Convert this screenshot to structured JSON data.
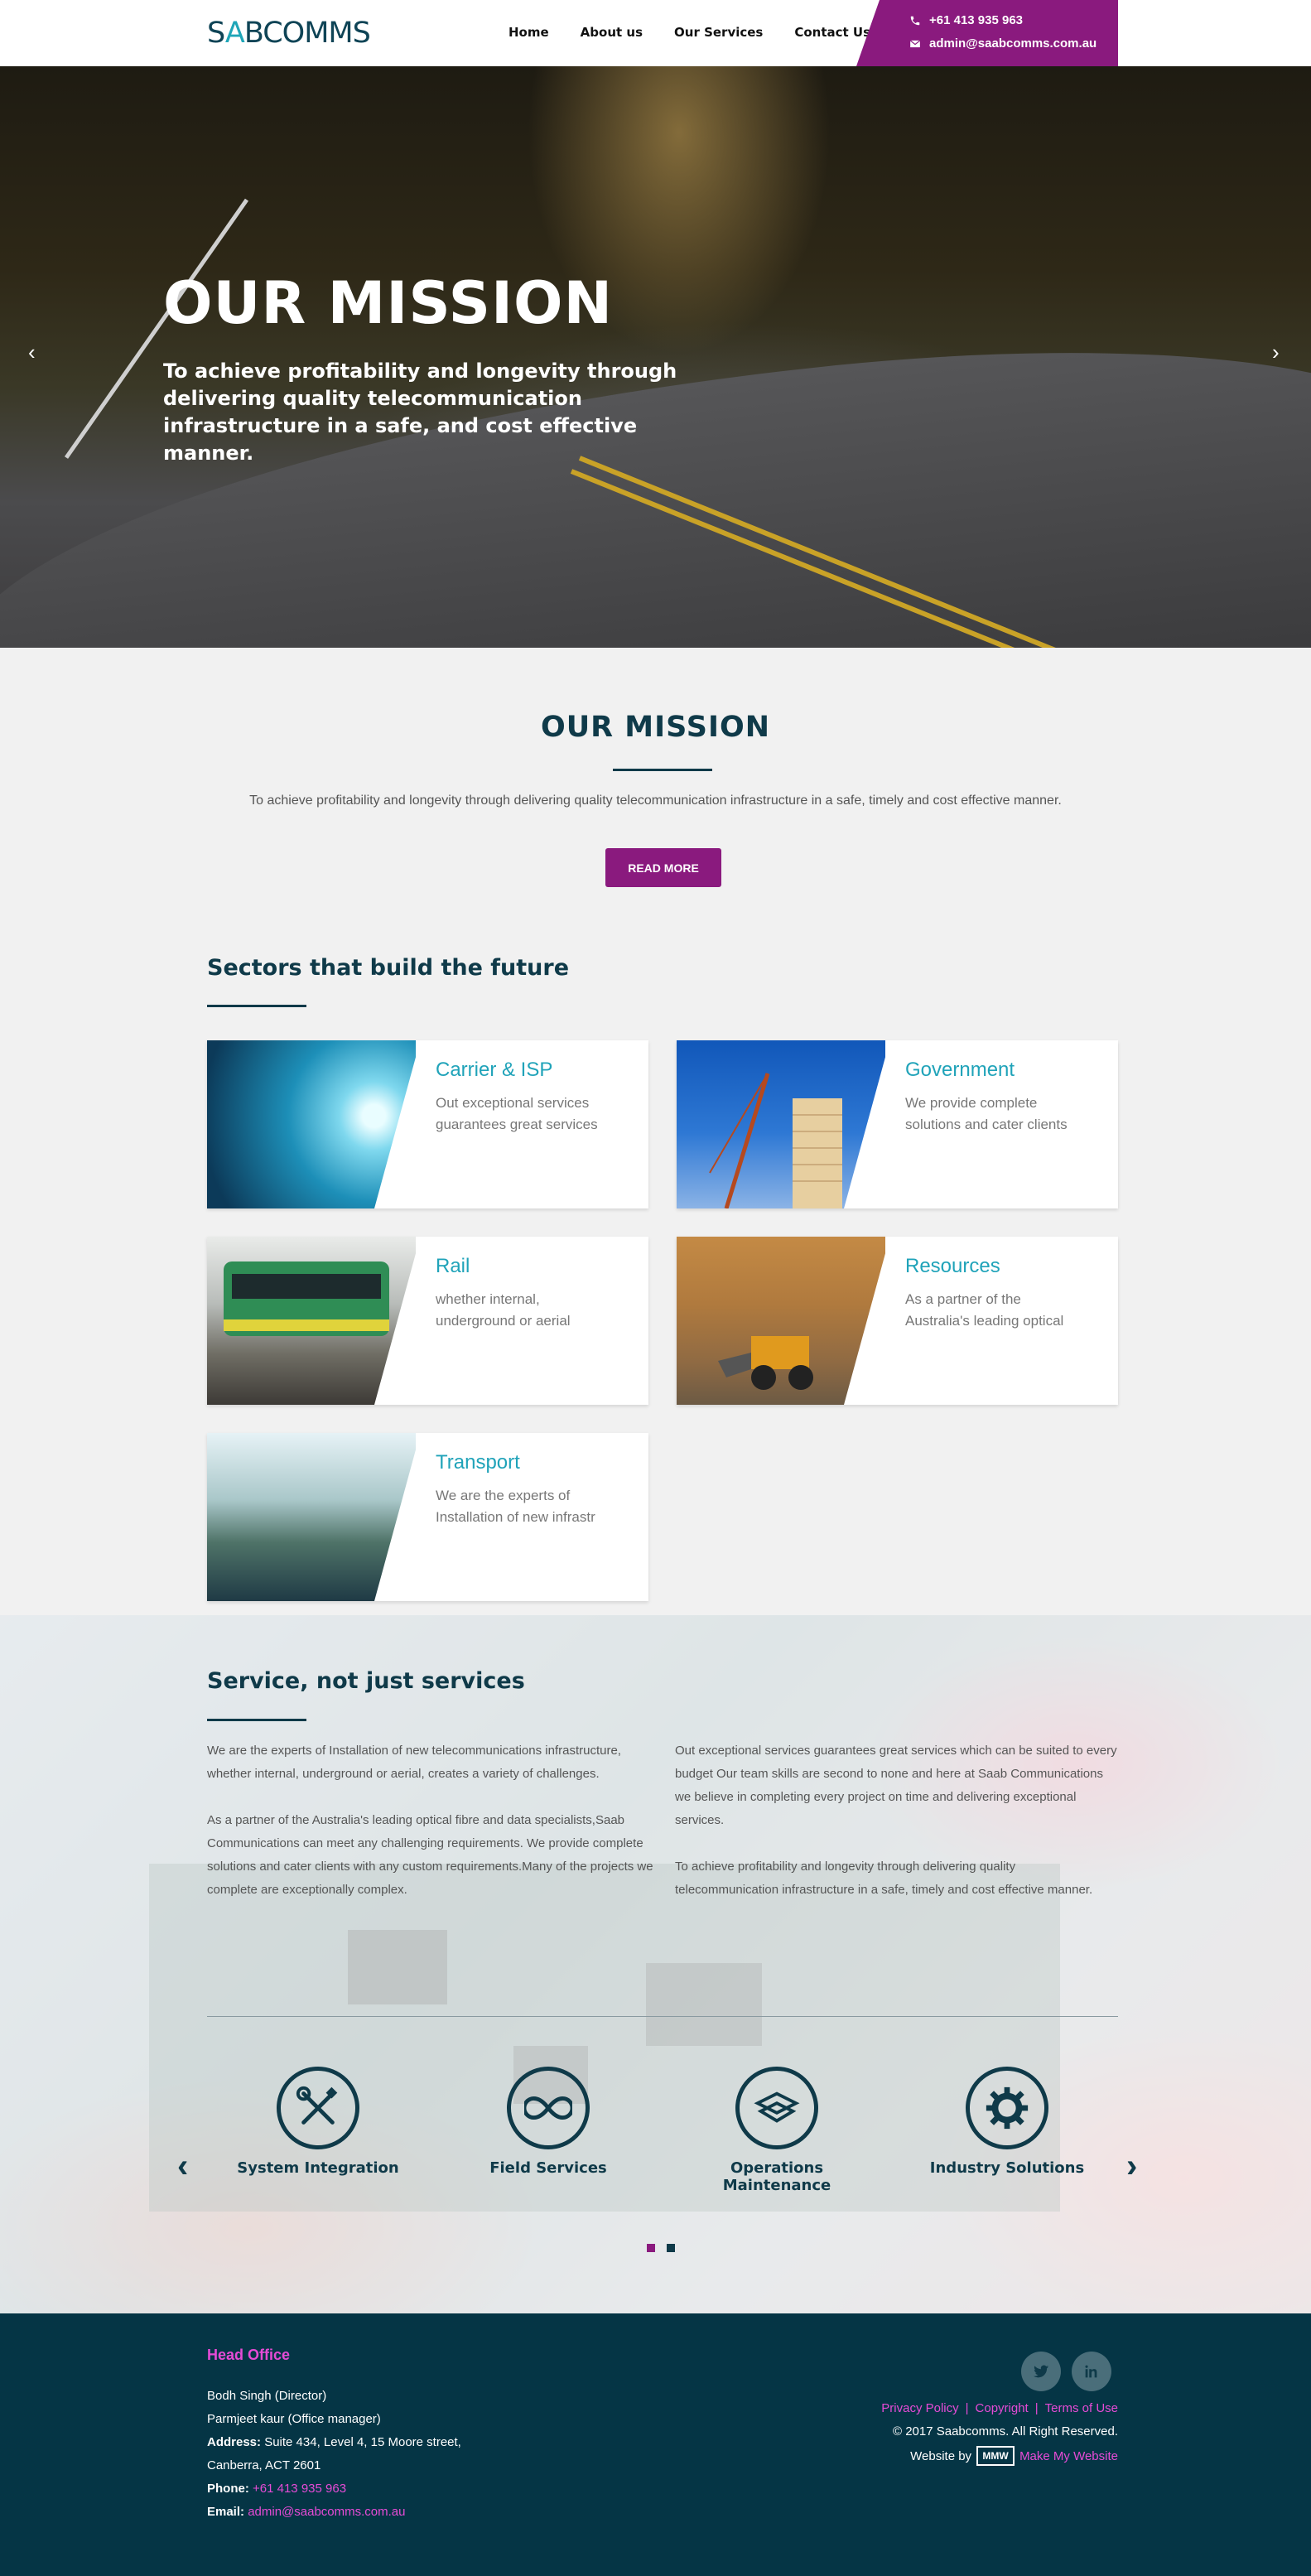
{
  "header": {
    "logo_text_1": "S",
    "logo_text_a": "A",
    "logo_text_2": "BCOMMS",
    "nav": [
      "Home",
      "About us",
      "Our Services",
      "Contact Us"
    ],
    "phone": "+61 413 935 963",
    "email": "admin@saabcomms.com.au"
  },
  "hero": {
    "title": "OUR MISSION",
    "subtitle": "To achieve profitability and longevity through delivering quality telecommunication infrastructure in a safe, and cost effective manner.",
    "prev_icon": "chevron-left-icon",
    "next_icon": "chevron-right-icon"
  },
  "mission": {
    "title": "OUR MISSION",
    "text": "To achieve profitability and longevity through delivering quality telecommunication infrastructure in a safe, timely and cost effective manner.",
    "button": "READ MORE"
  },
  "sectors": {
    "title": "Sectors that build the future",
    "cards": [
      {
        "title": "Carrier & ISP",
        "desc": "Out exceptional services guarantees great services"
      },
      {
        "title": "Government",
        "desc": "We provide complete solutions and cater clients"
      },
      {
        "title": "Rail",
        "desc": "whether internal, underground or aerial"
      },
      {
        "title": "Resources",
        "desc": "As a partner of the Australia's leading optical"
      },
      {
        "title": "Transport",
        "desc": "We are the experts of Installation of new infrastr"
      }
    ]
  },
  "services": {
    "title": "Service, not just services",
    "left": [
      "We are the experts of Installation of new telecommunications infrastructure, whether internal, underground or aerial, creates a variety of challenges.",
      "As a partner of the Australia's leading optical fibre and data specialists,Saab Communications can meet any challenging requirements. We provide complete solutions and cater clients with any custom requirements.Many of the projects we complete are exceptionally complex."
    ],
    "right": [
      "Out exceptional services guarantees great services which can be suited to every budget Our team skills are second to none and here at Saab Communications we believe in completing every project on time and delivering exceptional services.",
      "To achieve profitability and longevity through delivering quality telecommunication infrastructure in a safe, timely and cost effective manner."
    ],
    "items": [
      {
        "label": "System Integration",
        "icon": "tools-icon"
      },
      {
        "label": "Field Services",
        "icon": "infinity-icon"
      },
      {
        "label": "Operations Maintenance",
        "icon": "layers-icon"
      },
      {
        "label": "Industry Solutions",
        "icon": "gear-icon"
      }
    ],
    "dot_colors": [
      "#8a1a7e",
      "#0f3a49"
    ]
  },
  "footer": {
    "head": "Head Office",
    "person1": "Bodh Singh (Director)",
    "person2": "Parmjeet kaur (Office manager)",
    "address_label": "Address:",
    "address_1": "Suite 434, Level 4, 15 Moore street,",
    "address_2": "Canberra, ACT 2601",
    "phone_label": "Phone:",
    "phone": "+61 413 935 963",
    "email_label": "Email:",
    "email": "admin@saabcomms.com.au",
    "links": [
      "Privacy Policy",
      "Copyright",
      "Terms of Use"
    ],
    "copyright": "© 2017 Saabcomms. All Right Reserved.",
    "website_by": "Website by",
    "mmw_logo": "MMW",
    "make_my_website": "Make My Website"
  },
  "colors": {
    "brand_purple": "#8a1a7e",
    "brand_navy": "#0f3a49",
    "accent_teal": "#20a3b9",
    "footer_bg": "#053545",
    "footer_link": "#e64bd6"
  }
}
